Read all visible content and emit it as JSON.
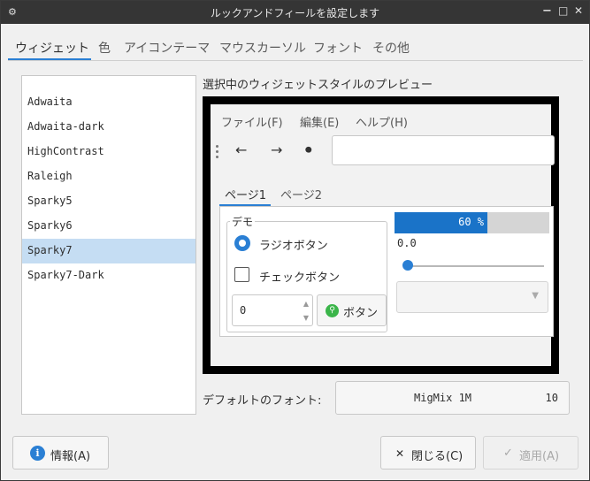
{
  "window": {
    "title": "ルックアンドフィールを設定します",
    "minimize": "−",
    "maximize": "□",
    "close": "✕"
  },
  "tabs": [
    {
      "label": "ウィジェット",
      "active": true
    },
    {
      "label": "色"
    },
    {
      "label": "アイコンテーマ"
    },
    {
      "label": "マウスカーソル"
    },
    {
      "label": "フォント"
    },
    {
      "label": "その他"
    }
  ],
  "themes": {
    "items": [
      "Adwaita",
      "Adwaita-dark",
      "HighContrast",
      "Raleigh",
      "Sparky5",
      "Sparky6",
      "Sparky7",
      "Sparky7-Dark"
    ],
    "selected": "Sparky7"
  },
  "preview": {
    "label": "選択中のウィジェットスタイルのプレビュー",
    "menus": [
      "ファイル(F)",
      "編集(E)",
      "ヘルプ(H)"
    ],
    "toolbar": {
      "back": "←",
      "forward": "→",
      "record": "⏺"
    },
    "pages": [
      "ページ1",
      "ページ2"
    ],
    "demo": {
      "frame_label": "デモ",
      "radio_label": "ラジオボタン",
      "check_label": "チェックボタン",
      "spin_value": "0",
      "button_label": "ボタン"
    },
    "progress": {
      "percent": 60,
      "text": "60 %"
    },
    "scale_value": "0.0"
  },
  "font": {
    "label": "デフォルトのフォント:",
    "name": "MigMix 1M",
    "size": "10"
  },
  "buttons": {
    "about": "情報(A)",
    "close": "閉じる(C)",
    "apply": "適用(A)"
  },
  "colors": {
    "accent": "#2a7fd4",
    "selection": "#c5ddf3",
    "progress": "#1a73c8"
  }
}
